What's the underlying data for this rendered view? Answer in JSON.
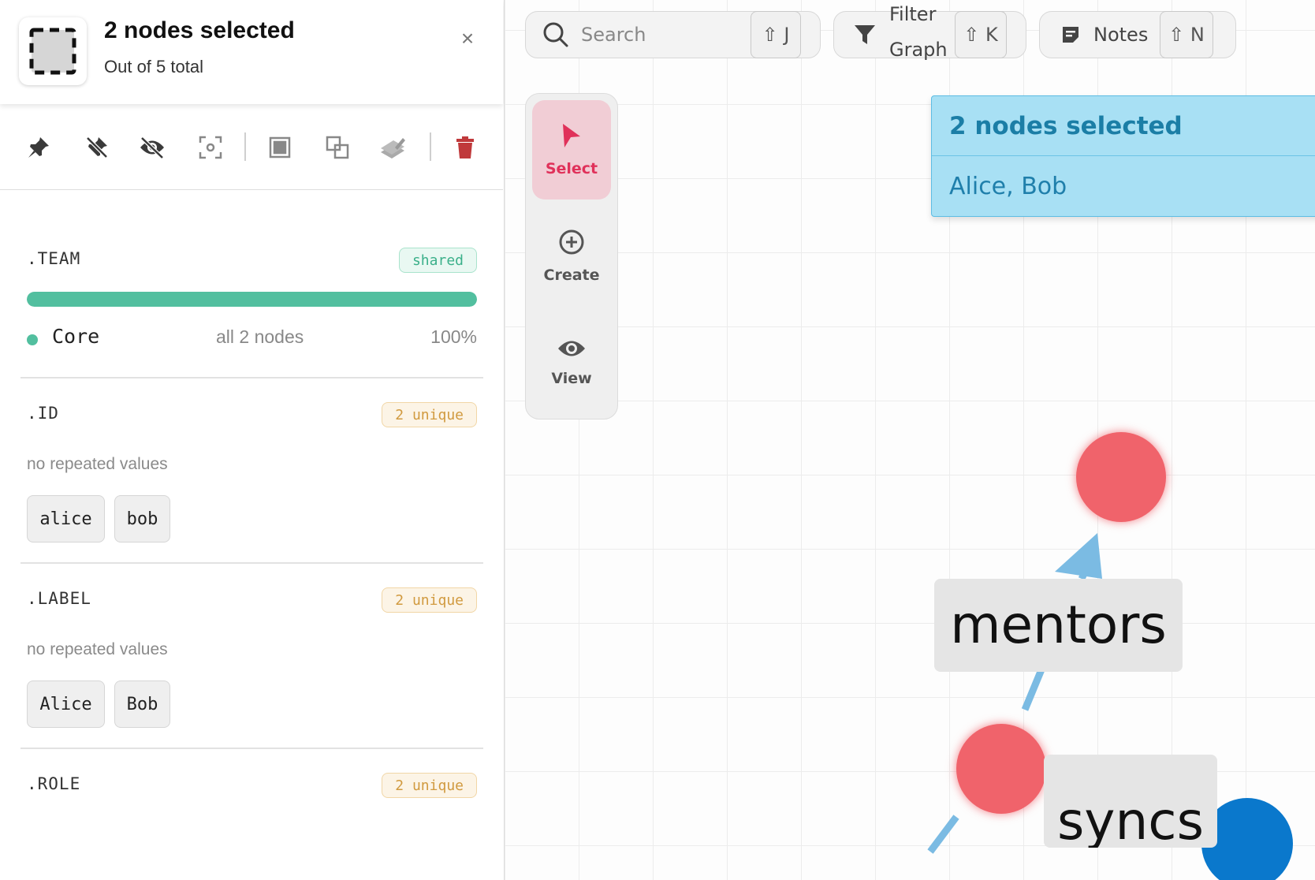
{
  "sidebar": {
    "title": "2 nodes selected",
    "subtitle": "Out of 5 total",
    "close_label": "×",
    "toolbar": [
      {
        "icon": "pin-icon"
      },
      {
        "icon": "unpin-icon"
      },
      {
        "icon": "hide-icon"
      },
      {
        "icon": "focus-icon"
      },
      {
        "icon": "group-icon"
      },
      {
        "icon": "ungroup-icon"
      },
      {
        "icon": "edit-icon"
      },
      {
        "icon": "delete-icon"
      }
    ],
    "properties": [
      {
        "name": ".TEAM",
        "badge": "shared",
        "badge_type": "shared",
        "share_fraction": 1.0,
        "value": "Core",
        "count_label": "all 2 nodes",
        "percent": "100%"
      },
      {
        "name": ".ID",
        "badge": "2 unique",
        "badge_type": "unique",
        "note": "no repeated values",
        "chips": [
          "alice",
          "bob"
        ]
      },
      {
        "name": ".LABEL",
        "badge": "2 unique",
        "badge_type": "unique",
        "note": "no repeated values",
        "chips": [
          "Alice",
          "Bob"
        ]
      },
      {
        "name": ".ROLE",
        "badge": "2 unique",
        "badge_type": "unique"
      }
    ]
  },
  "topbar": {
    "search": {
      "placeholder": "Search",
      "shortcut": "⇧ J"
    },
    "filter": {
      "label_line1": "Filter",
      "label_line2": "Graph",
      "shortcut": "⇧ K"
    },
    "notes": {
      "label": "Notes",
      "shortcut": "⇧ N"
    }
  },
  "tools": [
    {
      "label": "Select",
      "icon": "cursor-icon",
      "active": true
    },
    {
      "label": "Create",
      "icon": "plus-circle-icon",
      "active": false
    },
    {
      "label": "View",
      "icon": "eye-icon",
      "active": false
    }
  ],
  "tooltip": {
    "title": "2 nodes selected",
    "body": "Alice, Bob"
  },
  "graph": {
    "edge_labels": [
      "mentors",
      "syncs"
    ],
    "colors": {
      "node_selected": "#f0636b",
      "node_other": "#0a78cc",
      "edge": "#7bbbe3",
      "accent": "#e0315a",
      "team_bar": "#52bf9f"
    }
  }
}
